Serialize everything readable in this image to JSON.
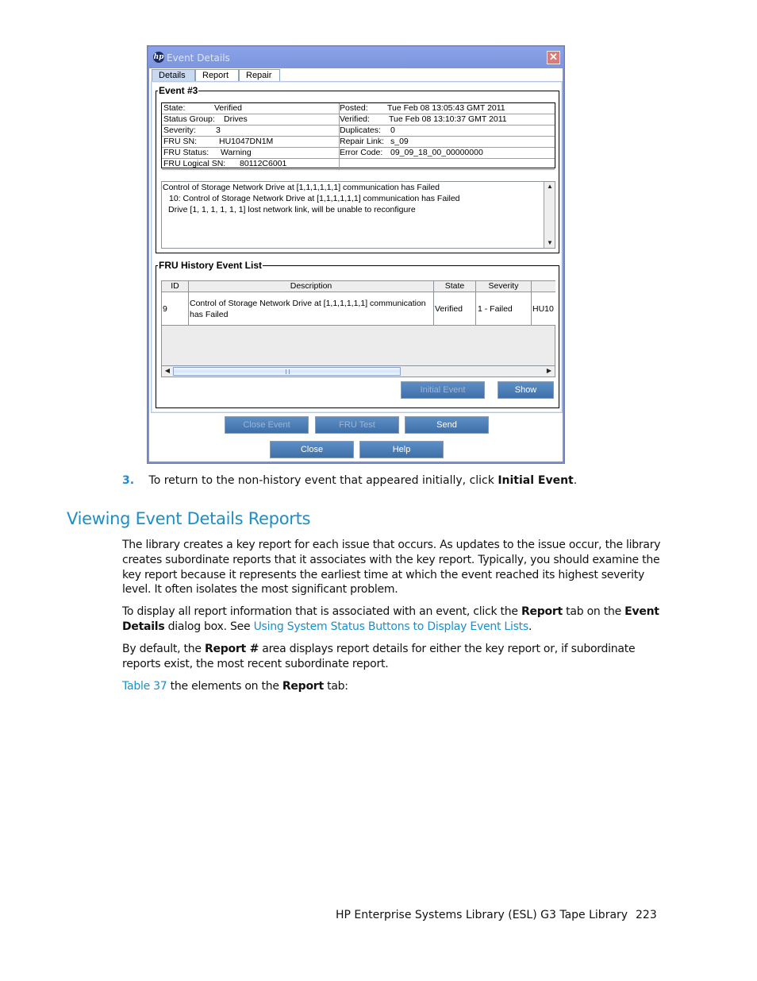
{
  "dialog": {
    "title": "Event Details",
    "tabs": [
      {
        "label": "Details",
        "active": true
      },
      {
        "label": "Report",
        "active": false
      },
      {
        "label": "Repair",
        "active": false
      }
    ],
    "event_group_title": "Event #3",
    "info_left": [
      {
        "label": "State:",
        "value": "Verified"
      },
      {
        "label": "Status Group:",
        "value": "Drives"
      },
      {
        "label": "Severity:",
        "value": "3"
      },
      {
        "label": "FRU SN:",
        "value": "HU1047DN1M"
      },
      {
        "label": "FRU Status:",
        "value": "Warning"
      },
      {
        "label": "FRU Logical SN:",
        "value": "80112C6001"
      }
    ],
    "info_right": [
      {
        "label": "Posted:",
        "value": "Tue Feb 08 13:05:43 GMT 2011"
      },
      {
        "label": "Verified:",
        "value": "Tue Feb 08 13:10:37 GMT 2011"
      },
      {
        "label": "Duplicates:",
        "value": "0"
      },
      {
        "label": "Repair Link:",
        "value": "s_09"
      },
      {
        "label": "Error Code:",
        "value": "09_09_18_00_00000000"
      },
      {
        "label": "",
        "value": ""
      }
    ],
    "messages": [
      "Control of Storage Network Drive at [1,1,1,1,1,1] communication has Failed",
      "10: Control of Storage Network Drive at [1,1,1,1,1,1] communication has Failed",
      "Drive [1, 1, 1, 1, 1, 1] lost network link, will be unable to reconfigure"
    ],
    "history_group_title": "FRU History Event List",
    "history_columns": [
      "ID",
      "Description",
      "State",
      "Severity",
      ""
    ],
    "history_rows": [
      {
        "id": "9",
        "description": "Control of Storage Network Drive at [1,1,1,1,1,1] communication has Failed",
        "state": "Verified",
        "severity": "1 - Failed",
        "extra": "HU10"
      }
    ],
    "buttons": {
      "initial_event": "Initial Event",
      "show": "Show",
      "close_event": "Close Event",
      "fru_test": "FRU Test",
      "send": "Send",
      "close": "Close",
      "help": "Help"
    },
    "colors": {
      "titlebar": "#7d95de",
      "button": "#4a7bb5",
      "close": "#d97c77"
    }
  },
  "document": {
    "step": {
      "number": "3.",
      "text_before": "To return to the non-history event that appeared initially, click ",
      "bold": "Initial Event",
      "text_after": "."
    },
    "heading": "Viewing Event Details Reports",
    "para1": "The library creates a key report for each issue that occurs. As updates to the issue occur, the library creates subordinate reports that it associates with the key report. Typically, you should examine the key report because it represents the earliest time at which the event reached its highest severity level. It often isolates the most significant problem.",
    "para2": {
      "t1": "To display all report information that is associated with an event, click the ",
      "b1": "Report",
      "t2": " tab on the ",
      "b2": "Event Details",
      "t3": " dialog box. See ",
      "link": "Using System Status Buttons to Display Event Lists",
      "t4": "."
    },
    "para3": {
      "t1": "By default, the ",
      "b1": "Report #",
      "t2": " area displays report details for either the key report or, if subordinate reports exist, the most recent subordinate report."
    },
    "para4": {
      "link": "Table 37",
      "t1": " the elements on the ",
      "b1": "Report",
      "t2": " tab:"
    },
    "footer": {
      "title": "HP Enterprise Systems Library (ESL) G3 Tape Library",
      "page": "223"
    },
    "accent_color": "#1a8fc9"
  }
}
